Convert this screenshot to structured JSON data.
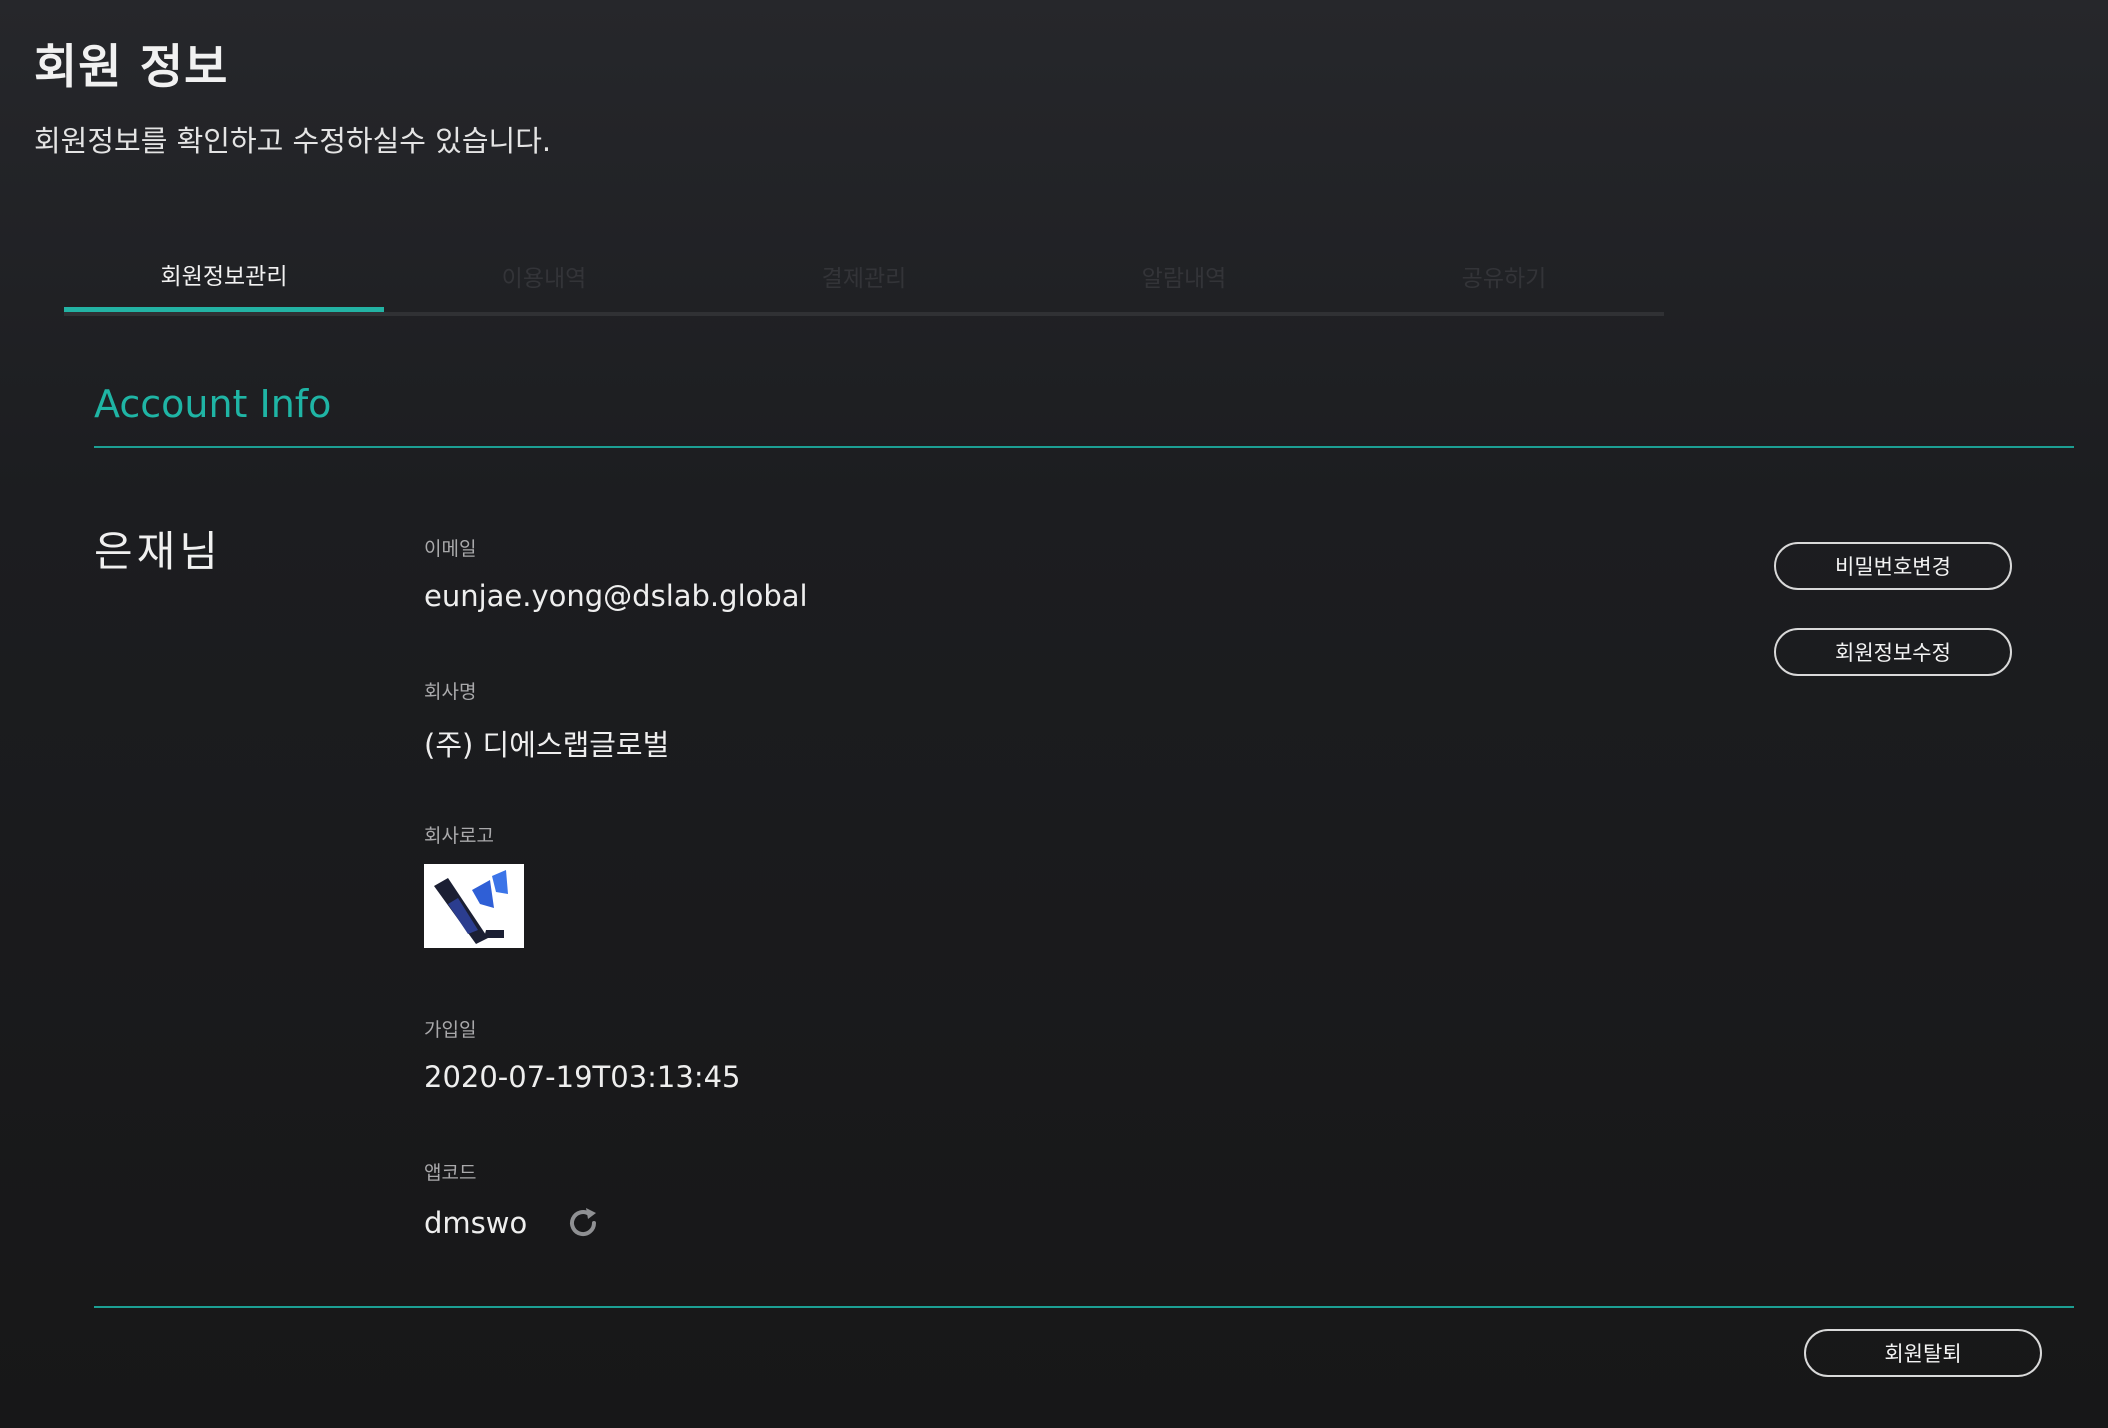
{
  "header": {
    "title": "회원 정보",
    "subtitle": "회원정보를 확인하고 수정하실수 있습니다."
  },
  "tabs": [
    {
      "label": "회원정보관리",
      "active": true
    },
    {
      "label": "이용내역",
      "active": false
    },
    {
      "label": "결제관리",
      "active": false
    },
    {
      "label": "알람내역",
      "active": false
    },
    {
      "label": "공유하기",
      "active": false
    }
  ],
  "account": {
    "section_title": "Account Info",
    "user_name": "은재님",
    "fields": {
      "email": {
        "label": "이메일",
        "value": "eunjae.yong@dslab.global"
      },
      "company": {
        "label": "회사명",
        "value": "(주) 디에스랩글로벌"
      },
      "logo": {
        "label": "회사로고"
      },
      "joined": {
        "label": "가입일",
        "value": "2020-07-19T03:13:45"
      },
      "appcode": {
        "label": "앱코드",
        "value": "dmswo"
      }
    },
    "buttons": {
      "change_password": "비밀번호변경",
      "edit_info": "회원정보수정",
      "withdraw": "회원탈퇴"
    }
  },
  "icons": {
    "refresh": "refresh-icon",
    "company_logo": "company-logo-image"
  },
  "colors": {
    "accent": "#1fb5a5",
    "background": "#1c1d20",
    "inactive_tab": "#333438"
  }
}
